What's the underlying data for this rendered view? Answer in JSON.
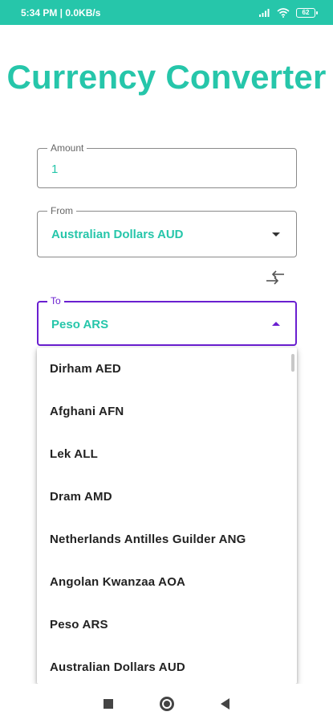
{
  "status_bar": {
    "time_speed": "5:34 PM | 0.0KB/s",
    "battery": "62",
    "icons": [
      "signal-icon",
      "wifi-icon",
      "battery-icon"
    ]
  },
  "app": {
    "title": "Currency Converter",
    "accent_color": "#26c6aa",
    "focus_color": "#6a1fd0"
  },
  "amount": {
    "label": "Amount",
    "value": "1"
  },
  "from": {
    "label": "From",
    "value": "Australian Dollars AUD"
  },
  "to": {
    "label": "To",
    "value": "Peso ARS"
  },
  "dropdown": {
    "items": [
      "Dirham AED",
      "Afghani AFN",
      "Lek ALL",
      "Dram AMD",
      "Netherlands Antilles Guilder ANG",
      "Angolan Kwanzaa AOA",
      "Peso ARS",
      "Australian Dollars AUD"
    ]
  },
  "nav": {
    "icons": [
      "recents-icon",
      "home-icon",
      "back-icon"
    ]
  }
}
